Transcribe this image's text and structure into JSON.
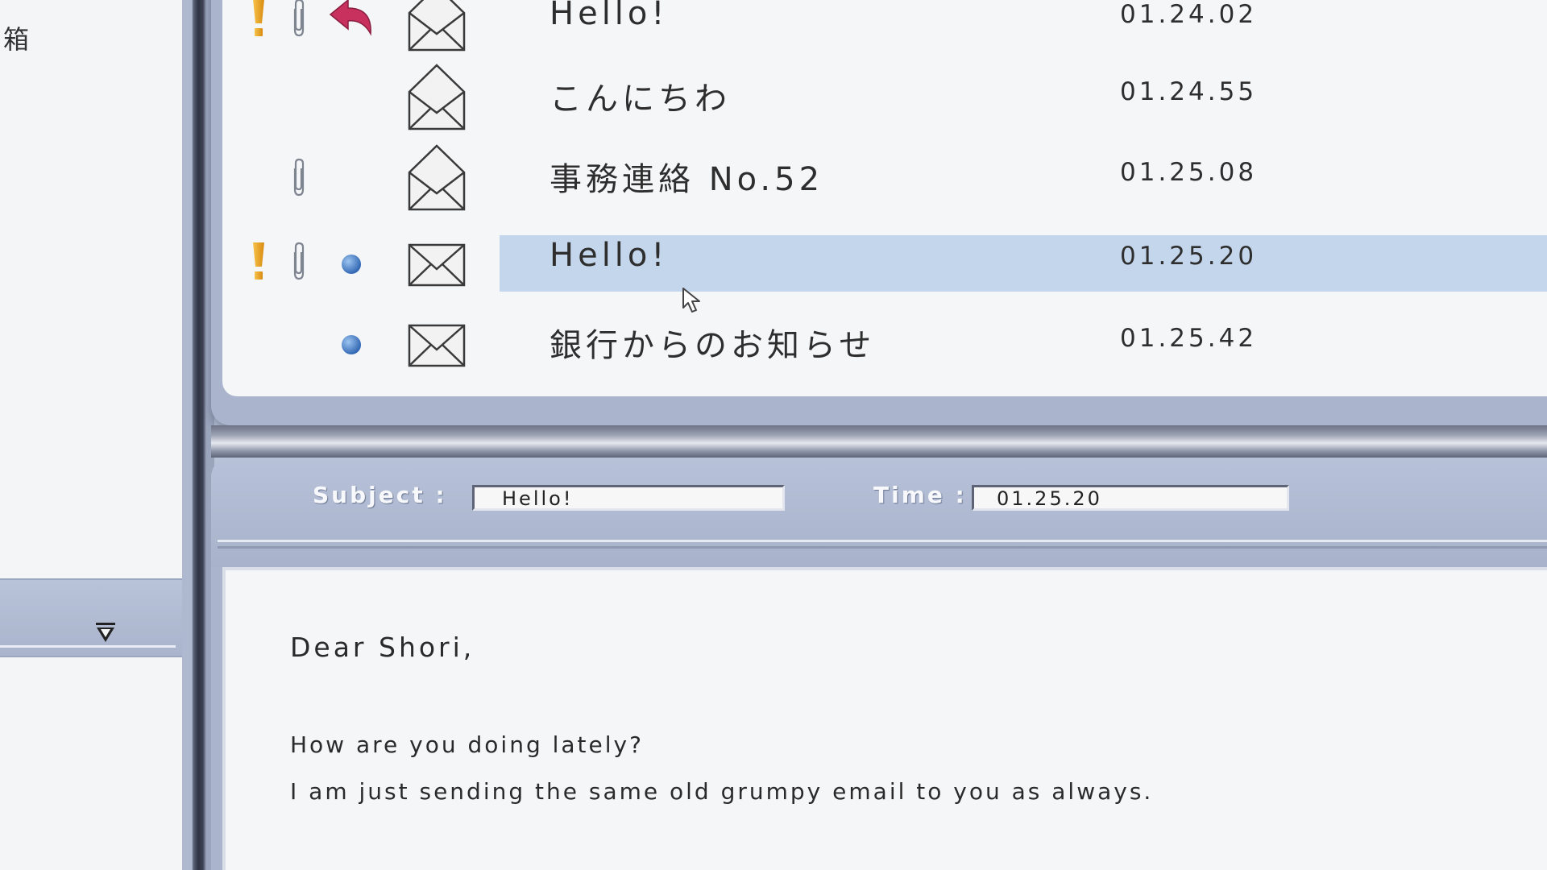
{
  "sidebar": {
    "folder_label": "箱"
  },
  "mail_list": [
    {
      "subject": "Hello!",
      "date": "01.24.02",
      "flag": true,
      "attachment": true,
      "status": "replied",
      "envelope": "opened",
      "selected": false
    },
    {
      "subject": "こんにちわ",
      "date": "01.24.55",
      "flag": false,
      "attachment": false,
      "status": "none",
      "envelope": "opened",
      "selected": false
    },
    {
      "subject": "事務連絡 No.52",
      "date": "01.25.08",
      "flag": false,
      "attachment": true,
      "status": "none",
      "envelope": "opened",
      "selected": false
    },
    {
      "subject": "Hello!",
      "date": "01.25.20",
      "flag": true,
      "attachment": true,
      "status": "unread",
      "envelope": "closed",
      "selected": true
    },
    {
      "subject": "銀行からのお知らせ",
      "date": "01.25.42",
      "flag": false,
      "attachment": false,
      "status": "unread",
      "envelope": "closed",
      "selected": false
    }
  ],
  "header": {
    "subject_label": "Subject :",
    "subject_value": "Hello!",
    "time_label": "Time :",
    "time_value": "01.25.20"
  },
  "body": {
    "greeting": "Dear  Shori,",
    "line1": "How are you doing lately?",
    "line2": "I am just sending the same old grumpy email to you as always."
  },
  "colors": {
    "selection": "#c4d6ec",
    "flag": "#e8a020",
    "reply_arrow": "#c4285a",
    "unread_dot": "#3c78c8",
    "panel": "#aab5cd"
  },
  "icons": {
    "flag": "exclamation-icon",
    "attachment": "paperclip-icon",
    "replied": "reply-arrow-icon",
    "unread": "unread-dot-icon",
    "opened": "open-envelope-icon",
    "closed": "closed-envelope-icon",
    "dropdown": "triangle-down-icon",
    "cursor": "mouse-cursor-icon"
  }
}
